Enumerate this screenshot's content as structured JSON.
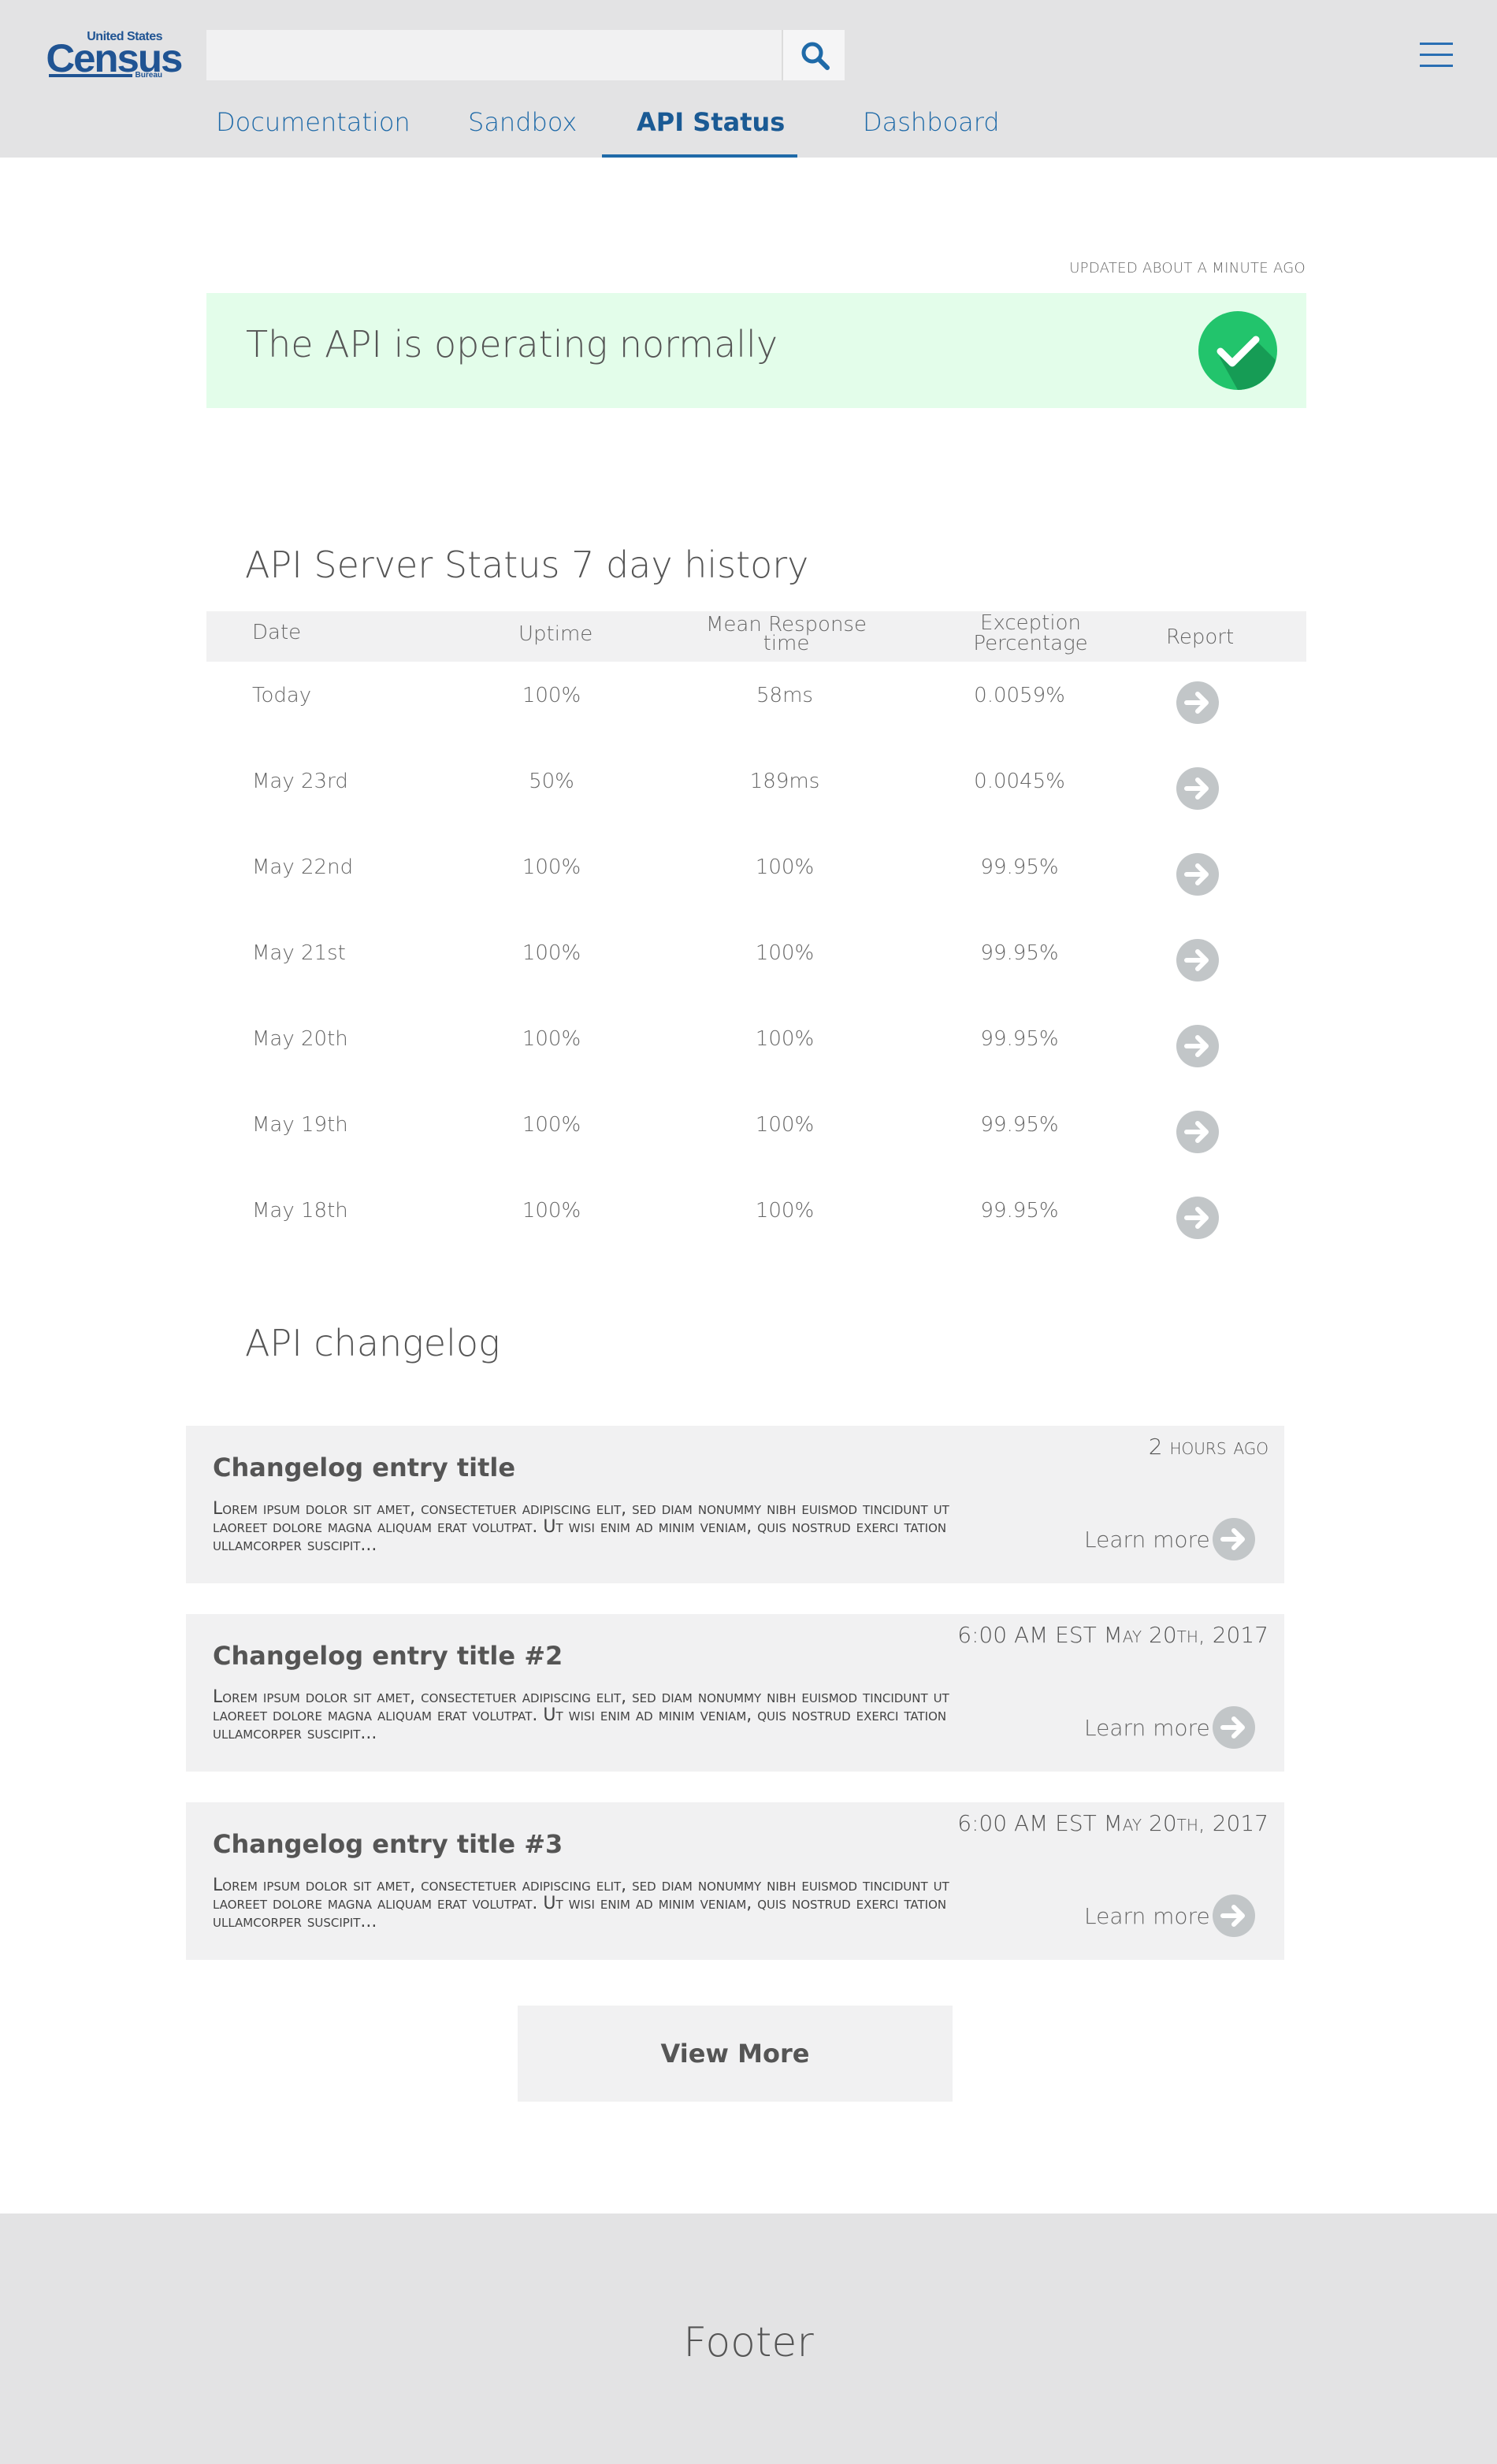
{
  "header": {
    "logo": {
      "line1": "United States",
      "line2": "Census",
      "line3": "Bureau"
    },
    "search": {
      "value": "",
      "placeholder": ""
    },
    "nav": [
      {
        "label": "Documentation"
      },
      {
        "label": "Sandbox"
      },
      {
        "label": "API Status",
        "active": true
      },
      {
        "label": "Dashboard"
      }
    ]
  },
  "status": {
    "updated": "UPDATED ABOUT A MINUTE AGO",
    "message": "The API is operating normally",
    "state": "ok",
    "color": "#1fb866"
  },
  "history": {
    "title": "API Server Status 7 day history",
    "columns": {
      "date": "Date",
      "uptime": "Uptime",
      "mean_line1": "Mean Response",
      "mean_line2": "time",
      "exception_line1": "Exception",
      "exception_line2": "Percentage",
      "report": "Report"
    },
    "rows": [
      {
        "date": "Today",
        "uptime": "100%",
        "mean": "58ms",
        "exception": "0.0059%"
      },
      {
        "date": "May 23rd",
        "uptime": "50%",
        "mean": "189ms",
        "exception": "0.0045%"
      },
      {
        "date": "May 22nd",
        "uptime": "100%",
        "mean": "100%",
        "exception": "99.95%"
      },
      {
        "date": "May 21st",
        "uptime": "100%",
        "mean": "100%",
        "exception": "99.95%"
      },
      {
        "date": "May 20th",
        "uptime": "100%",
        "mean": "100%",
        "exception": "99.95%"
      },
      {
        "date": "May 19th",
        "uptime": "100%",
        "mean": "100%",
        "exception": "99.95%"
      },
      {
        "date": "May 18th",
        "uptime": "100%",
        "mean": "100%",
        "exception": "99.95%"
      }
    ]
  },
  "changelog": {
    "title": "API changelog",
    "entries": [
      {
        "time": "2 hours ago",
        "title": "Changelog entry title",
        "body": "Lorem ipsum dolor sit amet, consectetuer adipiscing elit, sed diam nonummy nibh euismod tincidunt ut laoreet dolore magna aliquam erat volutpat. Ut wisi enim ad minim veniam, quis nostrud exerci tation ullamcorper suscipit...",
        "learn_more": "Learn more"
      },
      {
        "time": "6:00 AM EST May 20th, 2017",
        "title": "Changelog entry title #2",
        "body": "Lorem ipsum dolor sit amet, consectetuer adipiscing elit, sed diam nonummy nibh euismod tincidunt ut laoreet dolore magna aliquam erat volutpat. Ut wisi enim ad minim veniam, quis nostrud exerci tation ullamcorper suscipit...",
        "learn_more": "Learn more"
      },
      {
        "time": "6:00 AM EST May 20th, 2017",
        "title": "Changelog entry title #3",
        "body": "Lorem ipsum dolor sit amet, consectetuer adipiscing elit, sed diam nonummy nibh euismod tincidunt ut laoreet dolore magna aliquam erat volutpat. Ut wisi enim ad minim veniam, quis nostrud exerci tation ullamcorper suscipit...",
        "learn_more": "Learn more"
      }
    ],
    "view_more": "View More"
  },
  "footer": {
    "text": "Footer"
  },
  "icons": {
    "search": "search-icon",
    "menu": "hamburger-menu-icon",
    "status": "check-circle-icon",
    "report": "arrow-right-circle-icon"
  },
  "colors": {
    "brand": "#205493",
    "nav": "#1f6aa8",
    "status_bg": "#e3fdea",
    "arrow": "#c2c6c8"
  }
}
